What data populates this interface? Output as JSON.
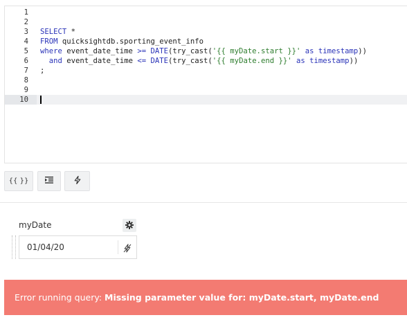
{
  "editor": {
    "line_numbers": [
      "1",
      "2",
      "3",
      "4",
      "5",
      "6",
      "7",
      "8",
      "9",
      "10"
    ],
    "lines": [
      [],
      [],
      [
        {
          "t": "SELECT",
          "c": "kw"
        },
        {
          "t": " *",
          "c": "plain"
        }
      ],
      [
        {
          "t": "FROM",
          "c": "kw"
        },
        {
          "t": " quicksightdb.sporting_event_info",
          "c": "plain"
        }
      ],
      [
        {
          "t": "where",
          "c": "kw"
        },
        {
          "t": " event_date_time ",
          "c": "plain"
        },
        {
          "t": ">=",
          "c": "op"
        },
        {
          "t": " ",
          "c": "plain"
        },
        {
          "t": "DATE",
          "c": "fn"
        },
        {
          "t": "(try_cast(",
          "c": "plain"
        },
        {
          "t": "'{{ myDate.start }}'",
          "c": "str"
        },
        {
          "t": " ",
          "c": "plain"
        },
        {
          "t": "as",
          "c": "kw"
        },
        {
          "t": " ",
          "c": "plain"
        },
        {
          "t": "timestamp",
          "c": "kw"
        },
        {
          "t": "))",
          "c": "plain"
        }
      ],
      [
        {
          "t": "  ",
          "c": "plain"
        },
        {
          "t": "and",
          "c": "kw"
        },
        {
          "t": " event_date_time ",
          "c": "plain"
        },
        {
          "t": "<=",
          "c": "op"
        },
        {
          "t": " ",
          "c": "plain"
        },
        {
          "t": "DATE",
          "c": "fn"
        },
        {
          "t": "(try_cast(",
          "c": "plain"
        },
        {
          "t": "'{{ myDate.end }}'",
          "c": "str"
        },
        {
          "t": " ",
          "c": "plain"
        },
        {
          "t": "as",
          "c": "kw"
        },
        {
          "t": " ",
          "c": "plain"
        },
        {
          "t": "timestamp",
          "c": "kw"
        },
        {
          "t": "))",
          "c": "plain"
        }
      ],
      [
        {
          "t": ";",
          "c": "plain"
        }
      ],
      [],
      [],
      []
    ],
    "active_line_index": 9
  },
  "toolbar": {
    "template_label": "{{ }}",
    "indent_icon": "indent-icon",
    "bolt_icon": "lightning-icon"
  },
  "parameter": {
    "name": "myDate",
    "value": "01/04/20",
    "settings_icon": "gear-icon",
    "dynamic_icon": "lightning-off-icon"
  },
  "error": {
    "prefix": "Error running query: ",
    "message": "Missing parameter value for: myDate.start, myDate.end"
  },
  "colors": {
    "error_bg": "#f37b72",
    "keyword": "#2a33b8",
    "string": "#2e7d2e"
  }
}
